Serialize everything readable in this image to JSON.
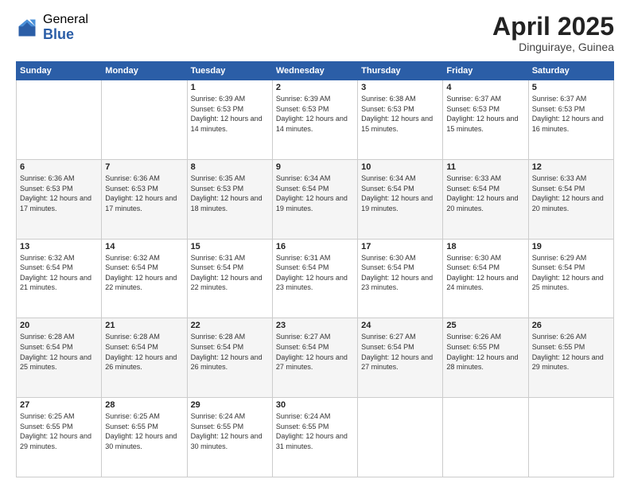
{
  "header": {
    "logo_general": "General",
    "logo_blue": "Blue",
    "title": "April 2025",
    "location": "Dinguiraye, Guinea"
  },
  "days_of_week": [
    "Sunday",
    "Monday",
    "Tuesday",
    "Wednesday",
    "Thursday",
    "Friday",
    "Saturday"
  ],
  "weeks": [
    [
      {
        "day": "",
        "info": ""
      },
      {
        "day": "",
        "info": ""
      },
      {
        "day": "1",
        "info": "Sunrise: 6:39 AM\nSunset: 6:53 PM\nDaylight: 12 hours and 14 minutes."
      },
      {
        "day": "2",
        "info": "Sunrise: 6:39 AM\nSunset: 6:53 PM\nDaylight: 12 hours and 14 minutes."
      },
      {
        "day": "3",
        "info": "Sunrise: 6:38 AM\nSunset: 6:53 PM\nDaylight: 12 hours and 15 minutes."
      },
      {
        "day": "4",
        "info": "Sunrise: 6:37 AM\nSunset: 6:53 PM\nDaylight: 12 hours and 15 minutes."
      },
      {
        "day": "5",
        "info": "Sunrise: 6:37 AM\nSunset: 6:53 PM\nDaylight: 12 hours and 16 minutes."
      }
    ],
    [
      {
        "day": "6",
        "info": "Sunrise: 6:36 AM\nSunset: 6:53 PM\nDaylight: 12 hours and 17 minutes."
      },
      {
        "day": "7",
        "info": "Sunrise: 6:36 AM\nSunset: 6:53 PM\nDaylight: 12 hours and 17 minutes."
      },
      {
        "day": "8",
        "info": "Sunrise: 6:35 AM\nSunset: 6:53 PM\nDaylight: 12 hours and 18 minutes."
      },
      {
        "day": "9",
        "info": "Sunrise: 6:34 AM\nSunset: 6:54 PM\nDaylight: 12 hours and 19 minutes."
      },
      {
        "day": "10",
        "info": "Sunrise: 6:34 AM\nSunset: 6:54 PM\nDaylight: 12 hours and 19 minutes."
      },
      {
        "day": "11",
        "info": "Sunrise: 6:33 AM\nSunset: 6:54 PM\nDaylight: 12 hours and 20 minutes."
      },
      {
        "day": "12",
        "info": "Sunrise: 6:33 AM\nSunset: 6:54 PM\nDaylight: 12 hours and 20 minutes."
      }
    ],
    [
      {
        "day": "13",
        "info": "Sunrise: 6:32 AM\nSunset: 6:54 PM\nDaylight: 12 hours and 21 minutes."
      },
      {
        "day": "14",
        "info": "Sunrise: 6:32 AM\nSunset: 6:54 PM\nDaylight: 12 hours and 22 minutes."
      },
      {
        "day": "15",
        "info": "Sunrise: 6:31 AM\nSunset: 6:54 PM\nDaylight: 12 hours and 22 minutes."
      },
      {
        "day": "16",
        "info": "Sunrise: 6:31 AM\nSunset: 6:54 PM\nDaylight: 12 hours and 23 minutes."
      },
      {
        "day": "17",
        "info": "Sunrise: 6:30 AM\nSunset: 6:54 PM\nDaylight: 12 hours and 23 minutes."
      },
      {
        "day": "18",
        "info": "Sunrise: 6:30 AM\nSunset: 6:54 PM\nDaylight: 12 hours and 24 minutes."
      },
      {
        "day": "19",
        "info": "Sunrise: 6:29 AM\nSunset: 6:54 PM\nDaylight: 12 hours and 25 minutes."
      }
    ],
    [
      {
        "day": "20",
        "info": "Sunrise: 6:28 AM\nSunset: 6:54 PM\nDaylight: 12 hours and 25 minutes."
      },
      {
        "day": "21",
        "info": "Sunrise: 6:28 AM\nSunset: 6:54 PM\nDaylight: 12 hours and 26 minutes."
      },
      {
        "day": "22",
        "info": "Sunrise: 6:28 AM\nSunset: 6:54 PM\nDaylight: 12 hours and 26 minutes."
      },
      {
        "day": "23",
        "info": "Sunrise: 6:27 AM\nSunset: 6:54 PM\nDaylight: 12 hours and 27 minutes."
      },
      {
        "day": "24",
        "info": "Sunrise: 6:27 AM\nSunset: 6:54 PM\nDaylight: 12 hours and 27 minutes."
      },
      {
        "day": "25",
        "info": "Sunrise: 6:26 AM\nSunset: 6:55 PM\nDaylight: 12 hours and 28 minutes."
      },
      {
        "day": "26",
        "info": "Sunrise: 6:26 AM\nSunset: 6:55 PM\nDaylight: 12 hours and 29 minutes."
      }
    ],
    [
      {
        "day": "27",
        "info": "Sunrise: 6:25 AM\nSunset: 6:55 PM\nDaylight: 12 hours and 29 minutes."
      },
      {
        "day": "28",
        "info": "Sunrise: 6:25 AM\nSunset: 6:55 PM\nDaylight: 12 hours and 30 minutes."
      },
      {
        "day": "29",
        "info": "Sunrise: 6:24 AM\nSunset: 6:55 PM\nDaylight: 12 hours and 30 minutes."
      },
      {
        "day": "30",
        "info": "Sunrise: 6:24 AM\nSunset: 6:55 PM\nDaylight: 12 hours and 31 minutes."
      },
      {
        "day": "",
        "info": ""
      },
      {
        "day": "",
        "info": ""
      },
      {
        "day": "",
        "info": ""
      }
    ]
  ]
}
